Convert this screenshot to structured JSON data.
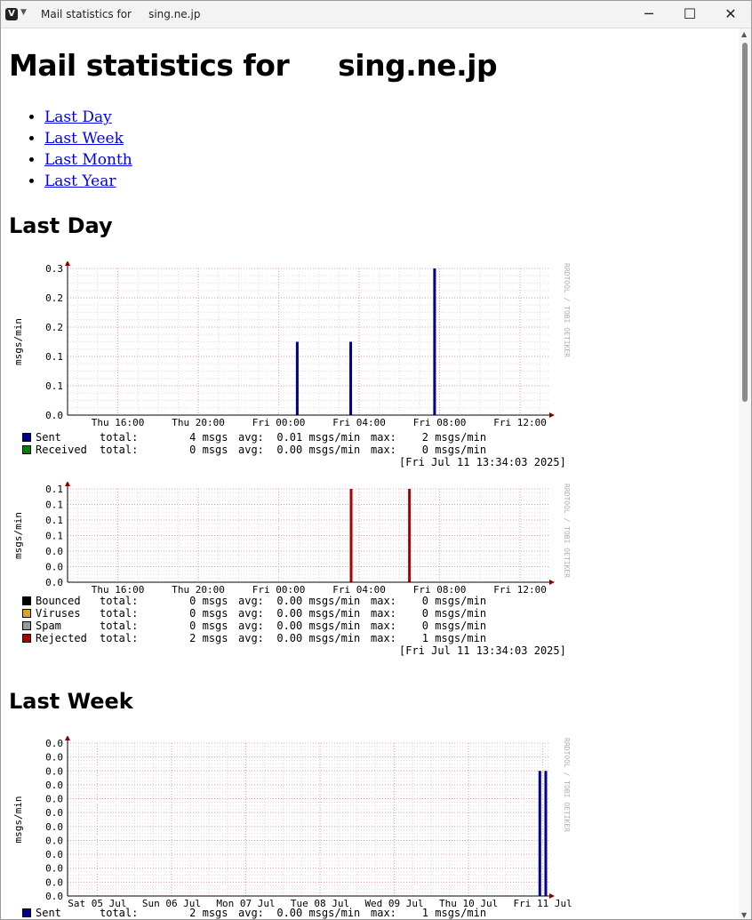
{
  "window": {
    "title": "Mail statistics for     sing.ne.jp",
    "minimize_glyph": "─",
    "maximize_glyph": "☐",
    "close_glyph": "✕"
  },
  "page": {
    "heading": "Mail statistics for     sing.ne.jp",
    "nav_links": [
      "Last Day",
      "Last Week",
      "Last Month",
      "Last Year"
    ],
    "sections": {
      "day": "Last Day",
      "week": "Last Week"
    }
  },
  "graph_text": {
    "ylabel": "msgs/min",
    "watermark": "RRDTOOL / TOBI OETIKER"
  },
  "graphs": {
    "day_traffic": {
      "legend": [
        {
          "name": "Sent",
          "color": "#00008b",
          "total": "total:        4 msgs",
          "avg": "avg:  0.01 msgs/min",
          "max": "max:    2 msgs/min"
        },
        {
          "name": "Received",
          "color": "#008000",
          "total": "total:        0 msgs",
          "avg": "avg:  0.00 msgs/min",
          "max": "max:    0 msgs/min"
        }
      ],
      "stamp": "[Fri Jul 11 13:34:03 2025]"
    },
    "day_rejects": {
      "legend": [
        {
          "name": "Bounced",
          "color": "#000000",
          "total": "total:        0 msgs",
          "avg": "avg:  0.00 msgs/min",
          "max": "max:    0 msgs/min"
        },
        {
          "name": "Viruses",
          "color": "#daa520",
          "total": "total:        0 msgs",
          "avg": "avg:  0.00 msgs/min",
          "max": "max:    0 msgs/min"
        },
        {
          "name": "Spam",
          "color": "#999999",
          "total": "total:        0 msgs",
          "avg": "avg:  0.00 msgs/min",
          "max": "max:    0 msgs/min"
        },
        {
          "name": "Rejected",
          "color": "#aa0000",
          "total": "total:        2 msgs",
          "avg": "avg:  0.00 msgs/min",
          "max": "max:    1 msgs/min"
        }
      ],
      "stamp": "[Fri Jul 11 13:34:03 2025]"
    },
    "week_traffic": {
      "legend": [
        {
          "name": "Sent",
          "color": "#00008b",
          "total": "total:        2 msgs",
          "avg": "avg:  0.00 msgs/min",
          "max": "max:    1 msgs/min"
        }
      ]
    }
  },
  "chart_data": [
    {
      "type": "bar",
      "ylabel": "msgs/min",
      "ytick_labels": [
        "0.0",
        "0.1",
        "0.1",
        "0.2",
        "0.2",
        "0.3"
      ],
      "ylim": [
        0,
        0.3
      ],
      "xlim_hours": [
        13.5,
        37.5
      ],
      "xtick_labels": [
        "Thu 16:00",
        "Thu 20:00",
        "Fri 00:00",
        "Fri 04:00",
        "Fri 08:00",
        "Fri 12:00"
      ],
      "xtick_hours": [
        16,
        20,
        24,
        28,
        32,
        36
      ],
      "grid": true,
      "series": [
        {
          "name": "Sent",
          "color": "#00008b",
          "points": [
            [
              24.92,
              0.15
            ],
            [
              27.58,
              0.15
            ],
            [
              31.75,
              0.3
            ]
          ]
        },
        {
          "name": "Received",
          "color": "#008000",
          "points": []
        }
      ]
    },
    {
      "type": "bar",
      "ylabel": "msgs/min",
      "ytick_labels": [
        "0.0",
        "0.0",
        "0.0",
        "0.1",
        "0.1",
        "0.1",
        "0.1"
      ],
      "ylim": [
        0,
        0.12
      ],
      "xlim_hours": [
        13.5,
        37.5
      ],
      "xtick_labels": [
        "Thu 16:00",
        "Thu 20:00",
        "Fri 00:00",
        "Fri 04:00",
        "Fri 08:00",
        "Fri 12:00"
      ],
      "xtick_hours": [
        16,
        20,
        24,
        28,
        32,
        36
      ],
      "grid": true,
      "series": [
        {
          "name": "Bounced",
          "color": "#000000",
          "points": []
        },
        {
          "name": "Viruses",
          "color": "#daa520",
          "points": []
        },
        {
          "name": "Spam",
          "color": "#999999",
          "points": []
        },
        {
          "name": "Rejected",
          "color": "#aa0000",
          "points": [
            [
              27.6,
              0.12
            ],
            [
              30.5,
              0.12
            ]
          ]
        }
      ]
    },
    {
      "type": "bar",
      "ylabel": "msgs/min",
      "ytick_labels": [
        "0.0",
        "0.0",
        "0.0",
        "0.0",
        "0.0",
        "0.0",
        "0.0",
        "0.0",
        "0.0",
        "0.0",
        "0.0",
        "0.0"
      ],
      "ylim": [
        0,
        0.011
      ],
      "xlim_days": [
        4.6,
        11.1
      ],
      "xtick_labels": [
        "Sat 05 Jul",
        "Sun 06 Jul",
        "Mon 07 Jul",
        "Tue 08 Jul",
        "Wed 09 Jul",
        "Thu 10 Jul",
        "Fri 11 Jul"
      ],
      "xtick_days": [
        5,
        6,
        7,
        8,
        9,
        10,
        11
      ],
      "grid": true,
      "series": [
        {
          "name": "Sent",
          "color": "#00008b",
          "points": [
            [
              10.96,
              0.009
            ],
            [
              11.04,
              0.009
            ]
          ]
        }
      ]
    }
  ]
}
